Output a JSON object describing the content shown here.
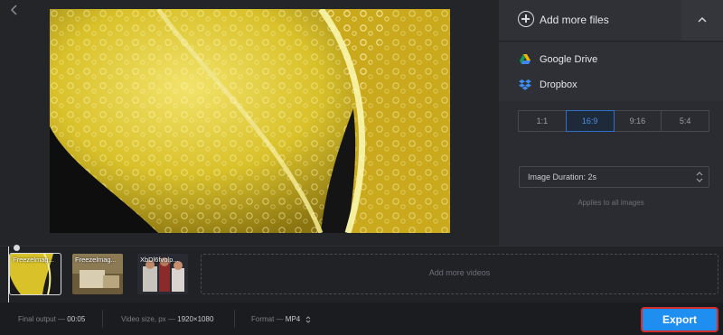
{
  "panel": {
    "add_files_label": "Add more files",
    "sources": [
      {
        "label": "Google Drive",
        "icon": "google-drive-icon"
      },
      {
        "label": "Dropbox",
        "icon": "dropbox-icon"
      }
    ],
    "aspect_ratios": [
      "1:1",
      "16:9",
      "9:16",
      "5:4"
    ],
    "selected_ratio": "16:9",
    "image_duration": "Image Duration: 2s",
    "applies_note": "Applies to all images"
  },
  "timeline": {
    "clips": [
      {
        "label": "Freezelmag..."
      },
      {
        "label": "Freezelmag..."
      },
      {
        "label": "XbDl6fvolp..."
      }
    ],
    "add_videos_label": "Add more videos"
  },
  "bottom": {
    "final_output_label": "Final output —",
    "final_output_value": "00:05",
    "video_size_label": "Video size, px —",
    "video_size_value": "1920×1080",
    "format_label": "Format —",
    "format_value": "MP4",
    "export_label": "Export"
  },
  "colors": {
    "accent": "#1e8ef0",
    "export_highlight": "#d32f2f",
    "selected_ratio": "#4a90e2"
  }
}
